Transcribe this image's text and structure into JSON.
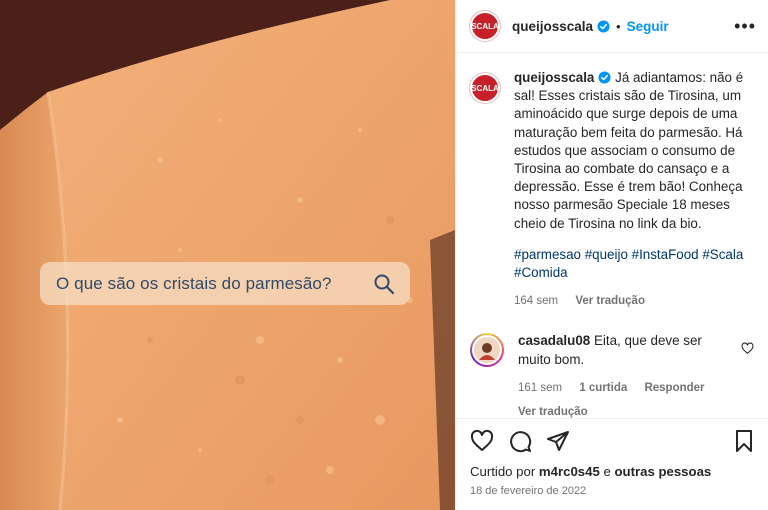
{
  "post": {
    "search_overlay_text": "O que são os cristais do parmesão?"
  },
  "header": {
    "avatar_label": "SCALA",
    "username": "queijosscala",
    "separator": "•",
    "follow_label": "Seguir",
    "more_label": "•••"
  },
  "caption": {
    "username": "queijosscala",
    "text": "Já adiantamos: não é sal! Esses cristais são de Tirosina, um aminoácido que surge depois de uma maturação bem feita do parmesão. Há estudos que associam o consumo de Tirosina ao combate do cansaço e a depressão. Esse é trem bão! Conheça nosso parmesão Speciale 18 meses cheio de Tirosina no link da bio.",
    "hashtags": "#parmesao #queijo #InstaFood #Scala #Comida",
    "time": "164 sem",
    "translate_label": "Ver tradução"
  },
  "comment": {
    "username": "casadalu08",
    "text": "Eita, que deve ser muito bom.",
    "time": "161 sem",
    "likes": "1 curtida",
    "reply_label": "Responder",
    "translate_label": "Ver tradução"
  },
  "likes": {
    "prefix": "Curtido por",
    "user": "m4rc0s45",
    "connector": "e",
    "others": "outras pessoas"
  },
  "date": "18 de fevereiro de 2022",
  "colors": {
    "brand_red": "#c8202a",
    "link_blue": "#0095f6",
    "hashtag_blue": "#00376b",
    "secondary_text": "#737373"
  },
  "icons": [
    "search-icon",
    "verified-badge-icon",
    "more-options-icon",
    "heart-icon",
    "comment-icon",
    "share-icon",
    "bookmark-icon"
  ]
}
